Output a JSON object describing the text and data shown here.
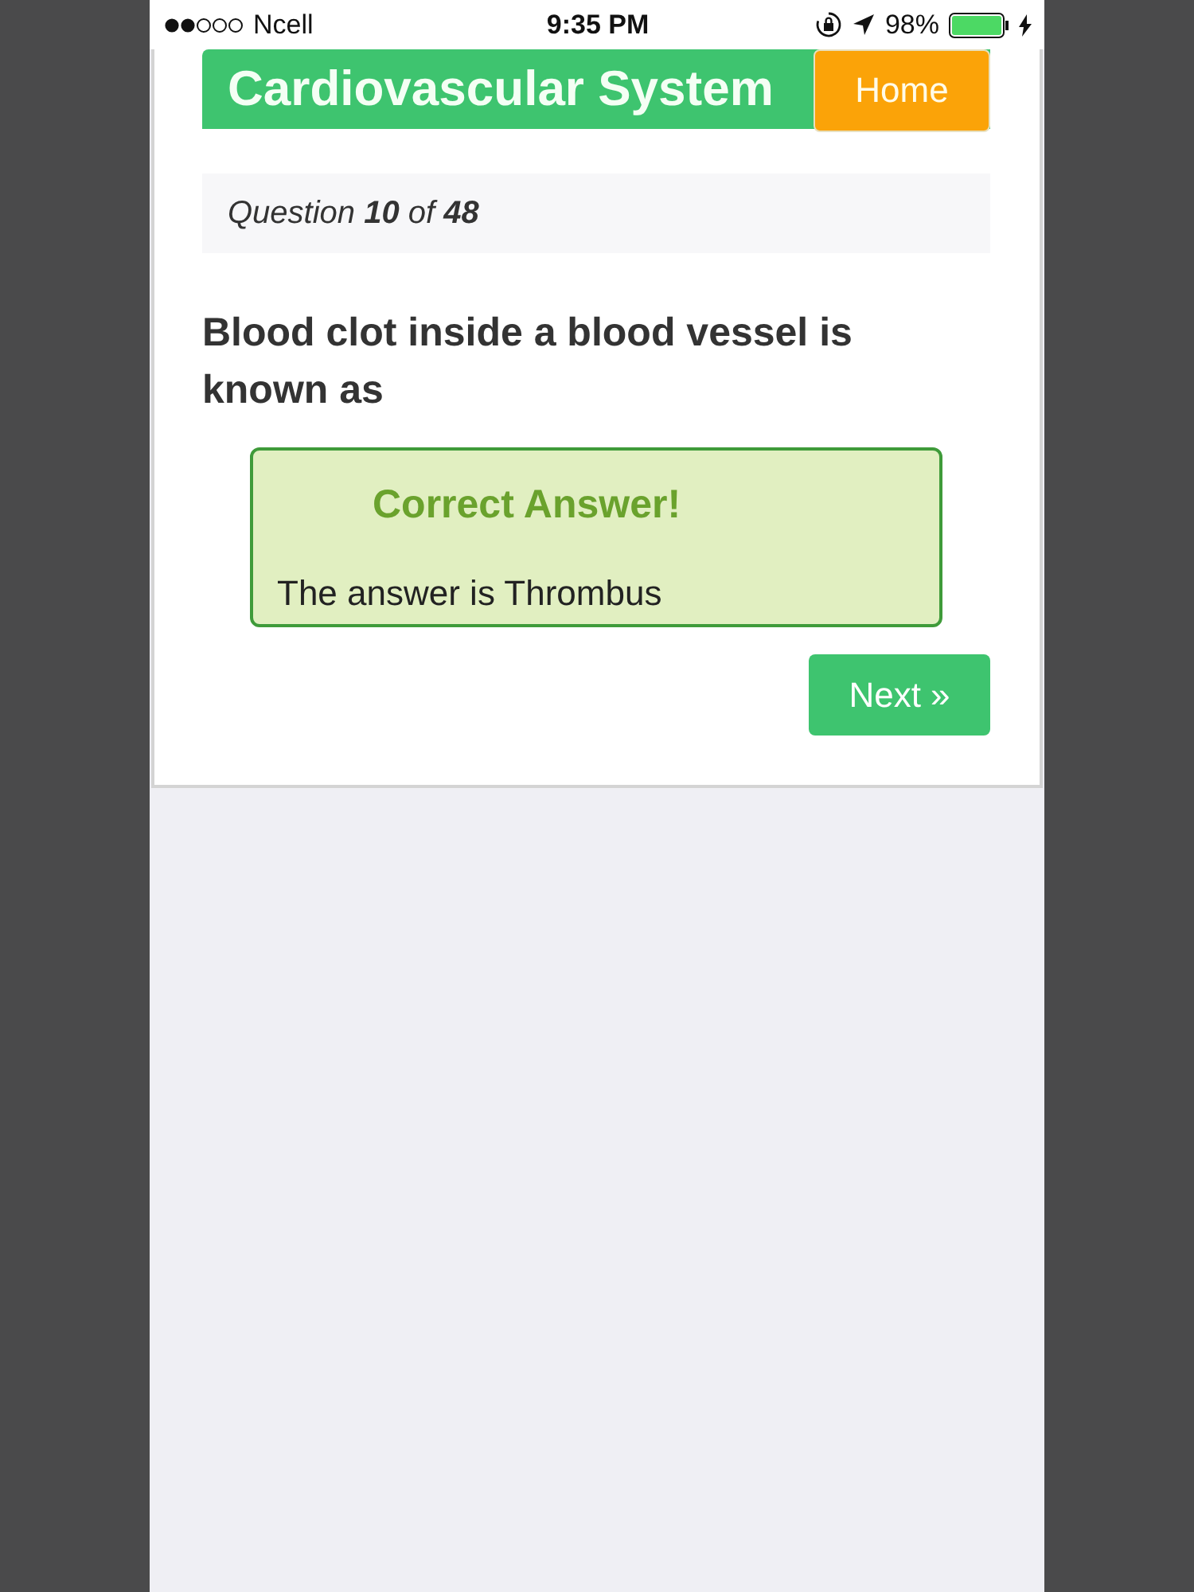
{
  "status_bar": {
    "carrier": "Ncell",
    "time": "9:35 PM",
    "battery": "98%"
  },
  "header": {
    "title": "Cardiovascular System",
    "home_button": "Home"
  },
  "progress": "Question **10** of **48**",
  "question": "Blood clot inside a blood vessel is known as",
  "feedback": {
    "kind": "correct",
    "title": "Correct Answer!",
    "message": "The answer is Thrombus"
  },
  "next_button": "Next »"
}
